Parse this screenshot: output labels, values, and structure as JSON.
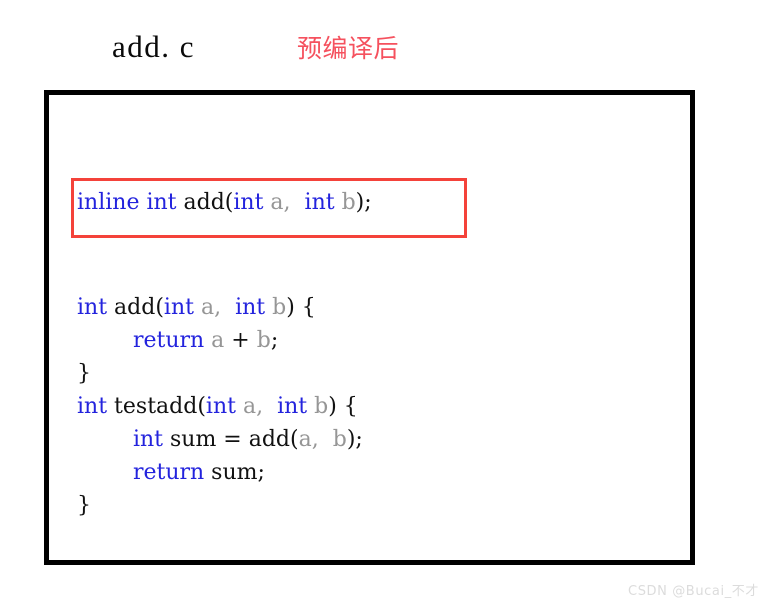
{
  "header": {
    "file_title": "add. c",
    "stage_label": "预编译后"
  },
  "colors": {
    "keyword_blue": "#2323dd",
    "variable_gray": "#969696",
    "plain_black": "#111111",
    "highlight_red": "#f4423a",
    "label_red": "#f5515e",
    "panel_border": "#000000",
    "watermark_gray": "#dcdcdc"
  },
  "code_panel": {
    "highlight_line": {
      "tokens": [
        {
          "text": "inline int",
          "kind": "keyword"
        },
        {
          "text": " add(",
          "kind": "plain"
        },
        {
          "text": "int",
          "kind": "keyword"
        },
        {
          "text": " a,",
          "kind": "variable"
        },
        {
          "text": "  ",
          "kind": "plain"
        },
        {
          "text": "int",
          "kind": "keyword"
        },
        {
          "text": " b",
          "kind": "variable"
        },
        {
          "text": ");",
          "kind": "plain"
        }
      ],
      "plain_text": "inline int add(int a,  int b);"
    },
    "lines": [
      {
        "plain_text": "int add(int a,  int b) {",
        "tokens": [
          {
            "text": "int",
            "kind": "keyword"
          },
          {
            "text": " add(",
            "kind": "plain"
          },
          {
            "text": "int",
            "kind": "keyword"
          },
          {
            "text": " a,",
            "kind": "variable"
          },
          {
            "text": "  ",
            "kind": "plain"
          },
          {
            "text": "int",
            "kind": "keyword"
          },
          {
            "text": " b",
            "kind": "variable"
          },
          {
            "text": ") {",
            "kind": "plain"
          }
        ]
      },
      {
        "plain_text": "        return a + b;",
        "tokens": [
          {
            "text": "        ",
            "kind": "plain"
          },
          {
            "text": "return",
            "kind": "keyword"
          },
          {
            "text": " a ",
            "kind": "variable"
          },
          {
            "text": "+",
            "kind": "plain"
          },
          {
            "text": " b",
            "kind": "variable"
          },
          {
            "text": ";",
            "kind": "plain"
          }
        ]
      },
      {
        "plain_text": "}",
        "tokens": [
          {
            "text": "}",
            "kind": "plain"
          }
        ]
      },
      {
        "plain_text": "int testadd(int a,  int b) {",
        "tokens": [
          {
            "text": "int",
            "kind": "keyword"
          },
          {
            "text": " testadd(",
            "kind": "plain"
          },
          {
            "text": "int",
            "kind": "keyword"
          },
          {
            "text": " a,",
            "kind": "variable"
          },
          {
            "text": "  ",
            "kind": "plain"
          },
          {
            "text": "int",
            "kind": "keyword"
          },
          {
            "text": " b",
            "kind": "variable"
          },
          {
            "text": ") {",
            "kind": "plain"
          }
        ]
      },
      {
        "plain_text": "        int sum = add(a,  b);",
        "tokens": [
          {
            "text": "        ",
            "kind": "plain"
          },
          {
            "text": "int",
            "kind": "keyword"
          },
          {
            "text": " sum = add(",
            "kind": "plain"
          },
          {
            "text": "a,",
            "kind": "variable"
          },
          {
            "text": "  ",
            "kind": "plain"
          },
          {
            "text": "b",
            "kind": "variable"
          },
          {
            "text": ");",
            "kind": "plain"
          }
        ]
      },
      {
        "plain_text": "        return sum;",
        "tokens": [
          {
            "text": "        ",
            "kind": "plain"
          },
          {
            "text": "return",
            "kind": "keyword"
          },
          {
            "text": " sum;",
            "kind": "plain"
          }
        ]
      },
      {
        "plain_text": "}",
        "tokens": [
          {
            "text": "}",
            "kind": "plain"
          }
        ]
      }
    ]
  },
  "watermark": {
    "text": "CSDN @Bucai_不才"
  }
}
